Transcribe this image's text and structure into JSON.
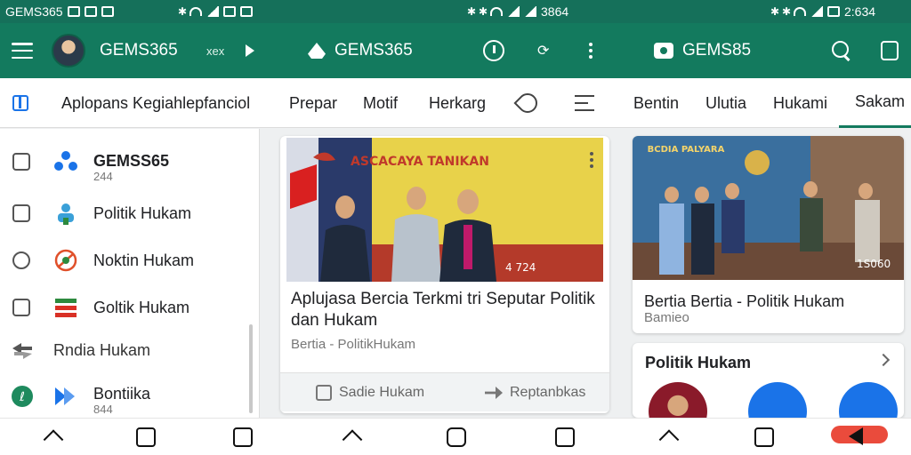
{
  "status_bar": {
    "left_text": "GEMS365",
    "center_text": "3864",
    "right_text": "2:634"
  },
  "app_bar": {
    "brand_text": "GEMS365",
    "extra_text": "xex",
    "center_title": "GEMS365",
    "right_title": "GEMS85"
  },
  "tabs": [
    {
      "label": "Aplopans Kegiahlepfanciol"
    },
    {
      "label": "Prepar"
    },
    {
      "label": "Motif"
    },
    {
      "label": "Herkarg"
    },
    {
      "label": "Bentin"
    },
    {
      "label": "Ulutia"
    },
    {
      "label": "Hukami"
    },
    {
      "label": "Sakam"
    }
  ],
  "sidebar": {
    "items": [
      {
        "label": "GEMSS65",
        "sub": "244"
      },
      {
        "label": "Politik Hukam"
      },
      {
        "label": "Noktin Hukam"
      },
      {
        "label": "Goltik Hukam"
      },
      {
        "label": "Rndia Hukam"
      },
      {
        "label": "Bontiika",
        "sub": "844"
      }
    ]
  },
  "main_card": {
    "banner_text": "ASCACAYA TANIKAN",
    "photo_badge": "4 724",
    "title": "Aplujasa Bercia Terkmi tri Seputar Politik dan Hukam",
    "meta": "Bertia - PolitikHukam",
    "actions": [
      {
        "label": "Sadie Hukam",
        "icon": "bookmark-icon"
      },
      {
        "label": "Reptanbkas",
        "icon": "share-arrow-icon"
      }
    ]
  },
  "side_card": {
    "banner_text": "BCDIA PALYARA",
    "photo_badge": "1S060",
    "title": "Bertia Bertia - Politik Hukam",
    "meta": "Bamieo"
  },
  "politik_card": {
    "heading": "Politik Hukam"
  },
  "colors": {
    "primary": "#137a5e",
    "status_bar": "#15705a",
    "accent_blue": "#1a73e8",
    "accent_red": "#ea4b3c"
  }
}
